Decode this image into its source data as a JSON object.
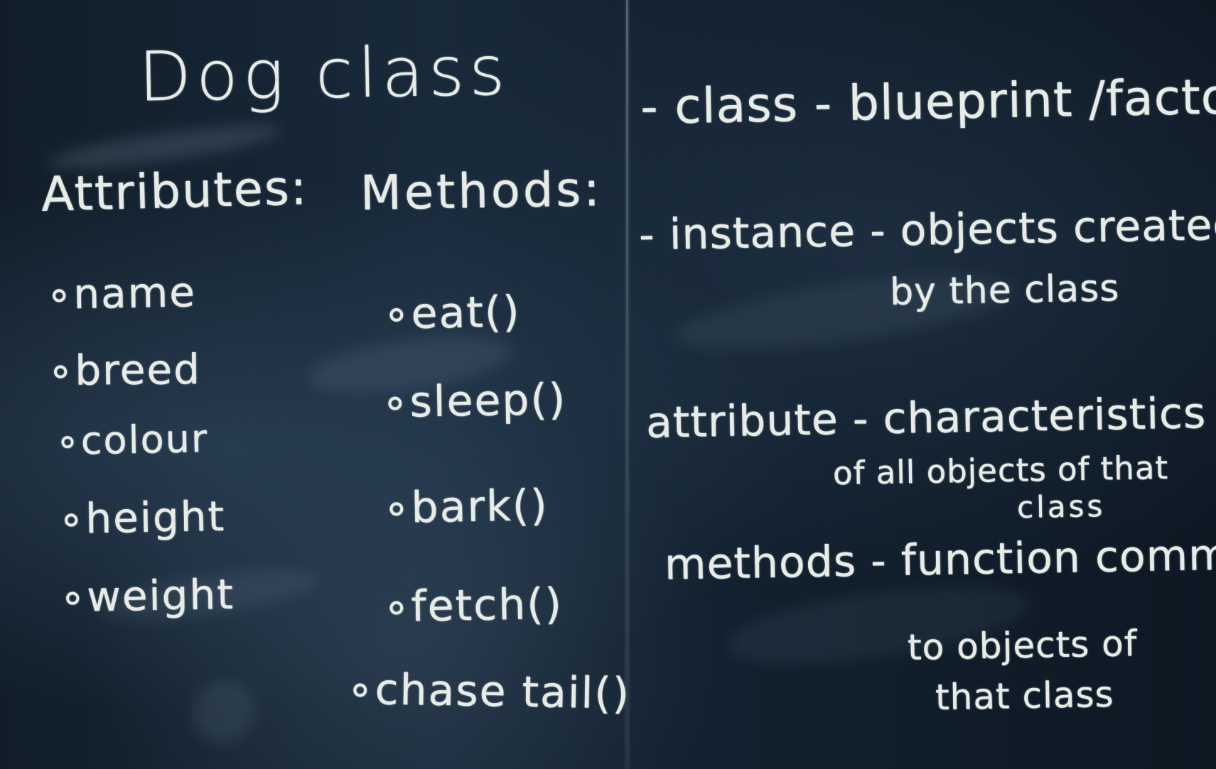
{
  "board": {
    "title": "Dog class",
    "left_headers": {
      "attributes": "Attributes:",
      "methods": "Methods:"
    },
    "attributes": [
      "∘name",
      "∘breed",
      "∘colour",
      "∘height",
      "∘weight"
    ],
    "methods": [
      "∘eat()",
      "∘sleep()",
      "∘bark()",
      "∘fetch()",
      "∘chase tail()"
    ],
    "definitions": [
      "- class - blueprint /factory",
      "- instance - objects created",
      "by the class",
      "attribute - characteristics",
      "of all objects of that",
      "class",
      "methods - function common",
      "to objects of",
      "that class"
    ]
  },
  "colors": {
    "chalkboard": "#132231",
    "chalk": "#e8ece7"
  }
}
